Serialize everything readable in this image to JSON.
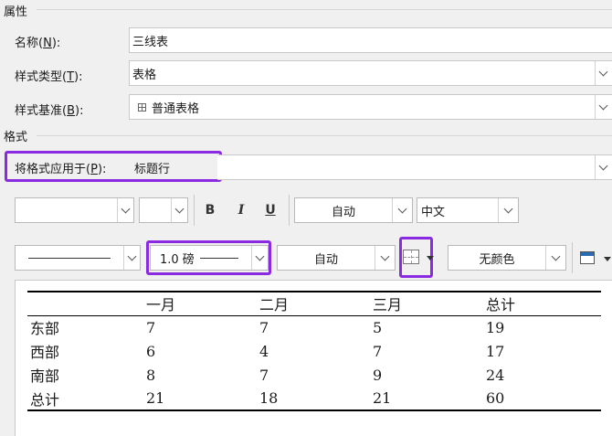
{
  "properties": {
    "section_title": "属性",
    "name": {
      "label": "名称",
      "hotkey": "N",
      "suffix": "):",
      "value": "三线表"
    },
    "style_type": {
      "label": "样式类型",
      "hotkey": "T",
      "suffix": "):",
      "value": "表格"
    },
    "style_based_on": {
      "label": "样式基准",
      "hotkey": "B",
      "suffix": "):",
      "value": "普通表格",
      "icon": "table-icon"
    }
  },
  "format": {
    "section_title": "格式",
    "apply_to": {
      "label": "将格式应用于",
      "hotkey": "P",
      "suffix": "):",
      "value": "标题行"
    },
    "font_row": {
      "font_name": "",
      "font_size": "",
      "bold": "B",
      "italic": "I",
      "underline": "U",
      "font_color": "自动",
      "script": "中文"
    },
    "border_row": {
      "line_style": "line-style",
      "line_weight": "1.0 磅",
      "border_color": "自动",
      "border_icon": "borders-icon",
      "shading_color": "无颜色",
      "shading_icon": "shading-icon"
    }
  },
  "preview": {
    "headers": [
      "",
      "一月",
      "二月",
      "三月",
      "总计"
    ],
    "rows": [
      [
        "东部",
        "7",
        "7",
        "5",
        "19"
      ],
      [
        "西部",
        "6",
        "4",
        "7",
        "17"
      ],
      [
        "南部",
        "8",
        "7",
        "9",
        "24"
      ],
      [
        "总计",
        "21",
        "18",
        "21",
        "60"
      ]
    ]
  },
  "colors": {
    "highlight": "#8a2be2"
  }
}
